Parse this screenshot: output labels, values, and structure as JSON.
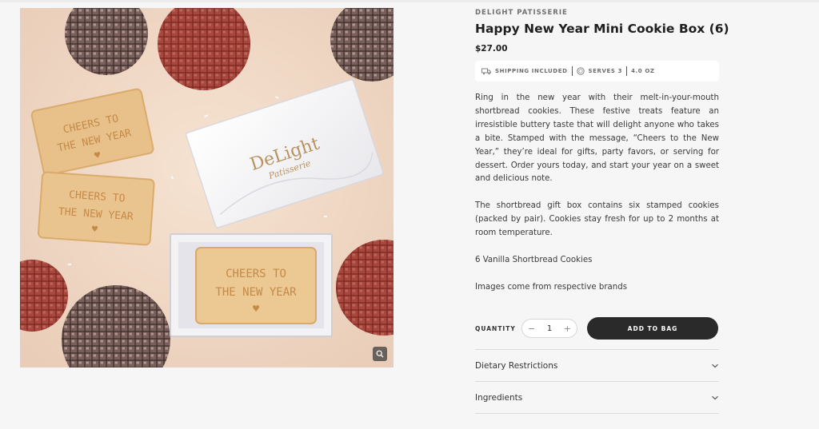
{
  "product": {
    "vendor": "DELIGHT PATISSERIE",
    "title": "Happy New Year Mini Cookie Box (6)",
    "price": "$27.00",
    "specs": {
      "shipping": "SHIPPING INCLUDED",
      "serves": "SERVES 3",
      "weight": "4.0 OZ"
    },
    "description": [
      "Ring in the new year with their melt-in-your-mouth shortbread cookies. These festive treats feature an irresistible buttery taste that will delight anyone who takes a bite. Stamped with the message, “Cheers to the New Year,” they’re ideal for gifts, party favors, or serving for dessert. Order yours today, and start your year on a sweet and delicious note.",
      "The shortbread gift box contains six stamped cookies (packed by pair). Cookies stay fresh for up to 2 months at room temperature.",
      "6 Vanilla Shortbread Cookies",
      "Images come from respective brands"
    ]
  },
  "image": {
    "cookie_line1": "CHEERS TO",
    "cookie_line2": "THE NEW YEAR",
    "box_brand": "DeLight",
    "box_sub": "Patisserie"
  },
  "purchase": {
    "quantity_label": "QUANTITY",
    "minus": "−",
    "quantity_value": "1",
    "plus": "+",
    "add_to_bag": "ADD TO BAG"
  },
  "accordion": [
    {
      "label": "Dietary Restrictions"
    },
    {
      "label": "Ingredients"
    }
  ],
  "colors": {
    "button_dark": "#2a2a2a",
    "background": "#f6f6f6",
    "cookie": "#e9c48f",
    "disco_red": "#8a2e28"
  }
}
